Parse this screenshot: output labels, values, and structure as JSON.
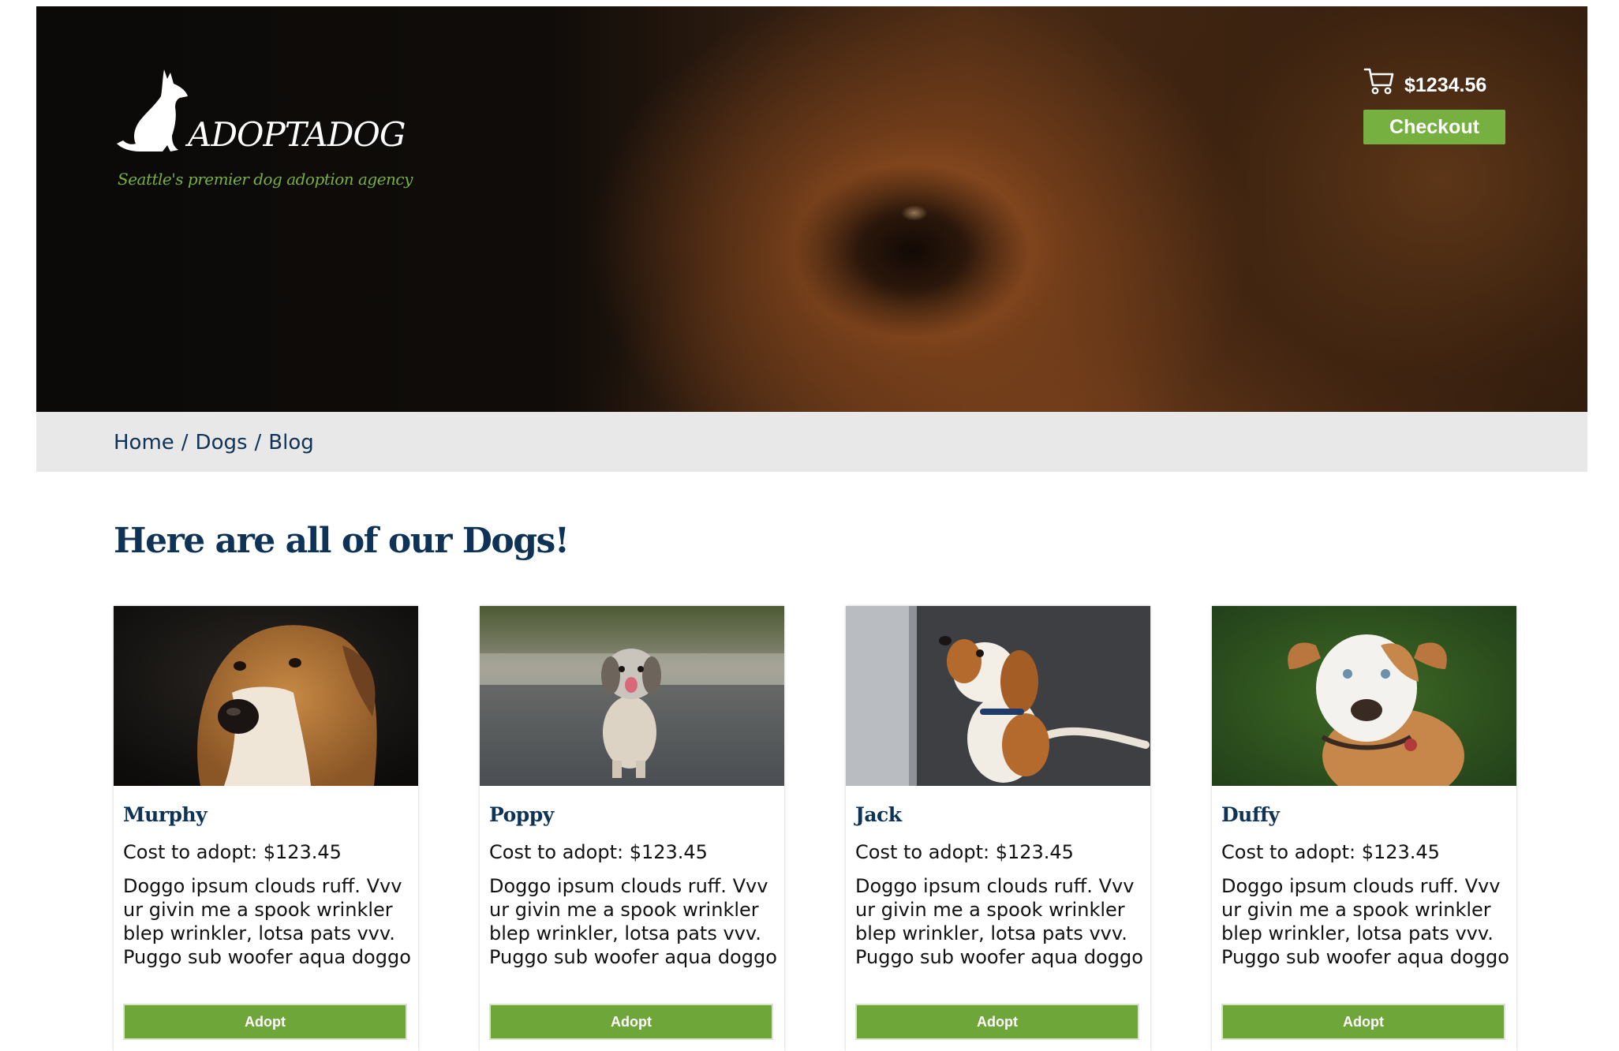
{
  "brand": {
    "name": "ADOPTADOG",
    "tagline": "Seattle's premier dog adoption agency"
  },
  "cart": {
    "total": "$1234.56",
    "checkout_label": "Checkout",
    "icon": "shopping-cart-icon"
  },
  "breadcrumb": {
    "items": [
      {
        "label": "Home"
      },
      {
        "label": "Dogs"
      },
      {
        "label": "Blog"
      }
    ],
    "separator": "/"
  },
  "main": {
    "title": "Here are all of our Dogs!"
  },
  "colors": {
    "accent_green": "#76b041",
    "navy": "#0e3356",
    "crumb_bg": "#e8e8e8"
  },
  "dogs": [
    {
      "name": "Murphy",
      "cost": "Cost to adopt: $123.45",
      "description": "Doggo ipsum clouds ruff. Vvv ur givin me a spook wrinkler blep wrinkler, lotsa pats vvv. Puggo sub woofer aqua doggo",
      "adopt_label": "Adopt"
    },
    {
      "name": "Poppy",
      "cost": "Cost to adopt: $123.45",
      "description": "Doggo ipsum clouds ruff. Vvv ur givin me a spook wrinkler blep wrinkler, lotsa pats vvv. Puggo sub woofer aqua doggo",
      "adopt_label": "Adopt"
    },
    {
      "name": "Jack",
      "cost": "Cost to adopt: $123.45",
      "description": "Doggo ipsum clouds ruff. Vvv ur givin me a spook wrinkler blep wrinkler, lotsa pats vvv. Puggo sub woofer aqua doggo",
      "adopt_label": "Adopt"
    },
    {
      "name": "Duffy",
      "cost": "Cost to adopt: $123.45",
      "description": "Doggo ipsum clouds ruff. Vvv ur givin me a spook wrinkler blep wrinkler, lotsa pats vvv. Puggo sub woofer aqua doggo",
      "adopt_label": "Adopt"
    }
  ]
}
